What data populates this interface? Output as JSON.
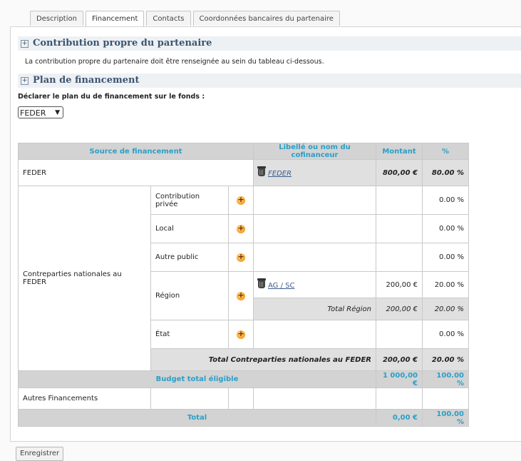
{
  "tabs": [
    "Description",
    "Financement",
    "Contacts",
    "Coordonnées bancaires du partenaire"
  ],
  "sections": {
    "contribution_title": "Contribution propre du partenaire",
    "contribution_text": "La contribution propre du partenaire doit être renseignée au sein du tableau ci-dessous.",
    "plan_title": "Plan de financement"
  },
  "fund": {
    "label": "Déclarer le plan du de financement sur le fonds :",
    "selected": "FEDER"
  },
  "table": {
    "headers": {
      "source": "Source de financement",
      "libelle": "Libellé ou nom du cofinanceur",
      "montant": "Montant",
      "pct": "%"
    },
    "feder": {
      "label": "FEDER",
      "link": "FEDER",
      "montant": "800,00 €",
      "pct": "80.00 %"
    },
    "cn_label": "Contreparties nationales au FEDER",
    "rows": {
      "privee": {
        "label": "Contribution privée",
        "pct": "0.00 %"
      },
      "local": {
        "label": "Local",
        "pct": "0.00 %"
      },
      "autre": {
        "label": "Autre public",
        "pct": "0.00 %"
      },
      "region": {
        "label": "Région",
        "link": "AG / SC",
        "montant": "200,00 €",
        "pct": "20.00 %",
        "total_label": "Total Région",
        "total_montant": "200,00 €",
        "total_pct": "20.00 %"
      },
      "etat": {
        "label": "État",
        "pct": "0.00 %"
      }
    },
    "total_cn": {
      "label": "Total Contreparties nationales au FEDER",
      "montant": "200,00 €",
      "pct": "20.00 %"
    },
    "budget": {
      "label": "Budget total éligible",
      "montant": "1 000,00 €",
      "pct": "100.00 %"
    },
    "autres": {
      "label": "Autres Financements"
    },
    "total": {
      "label": "Total",
      "montant": "0,00 €",
      "pct": "100.00 %"
    }
  },
  "save_button": "Enregistrer"
}
